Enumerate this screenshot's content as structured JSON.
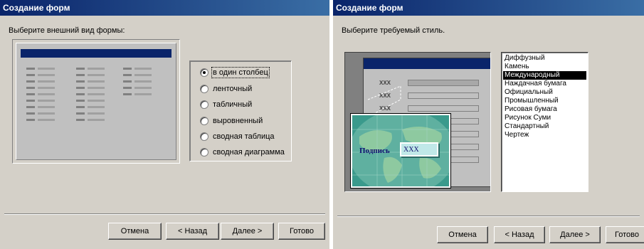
{
  "dialog1": {
    "title": "Создание форм",
    "prompt": "Выберите внешний вид формы:",
    "options": [
      {
        "label": "в один столбец",
        "selected": true
      },
      {
        "label": "ленточный",
        "selected": false
      },
      {
        "label": "табличный",
        "selected": false
      },
      {
        "label": "выровненный",
        "selected": false
      },
      {
        "label": "сводная таблица",
        "selected": false
      },
      {
        "label": "сводная диаграмма",
        "selected": false
      }
    ],
    "buttons": {
      "cancel": "Отмена",
      "back": "< Назад",
      "next": "Далее >",
      "finish": "Готово"
    }
  },
  "dialog2": {
    "title": "Создание форм",
    "prompt": "Выберите требуемый стиль.",
    "preview": {
      "field_placeholder": "XXX",
      "label": "Подпись",
      "textbox": "XXX"
    },
    "styles": [
      "Диффузный",
      "Камень",
      "Международный",
      "Наждачная бумага",
      "Официальный",
      "Промышленный",
      "Рисовая бумага",
      "Рисунок Суми",
      "Стандартный",
      "Чертеж"
    ],
    "selected_style": "Международный",
    "buttons": {
      "cancel": "Отмена",
      "back": "< Назад",
      "next": "Далее >",
      "finish": "Готово"
    }
  },
  "colors": {
    "titlebar": "#0a246a",
    "dialog_bg": "#d4d0c8",
    "selection": "#000000"
  }
}
